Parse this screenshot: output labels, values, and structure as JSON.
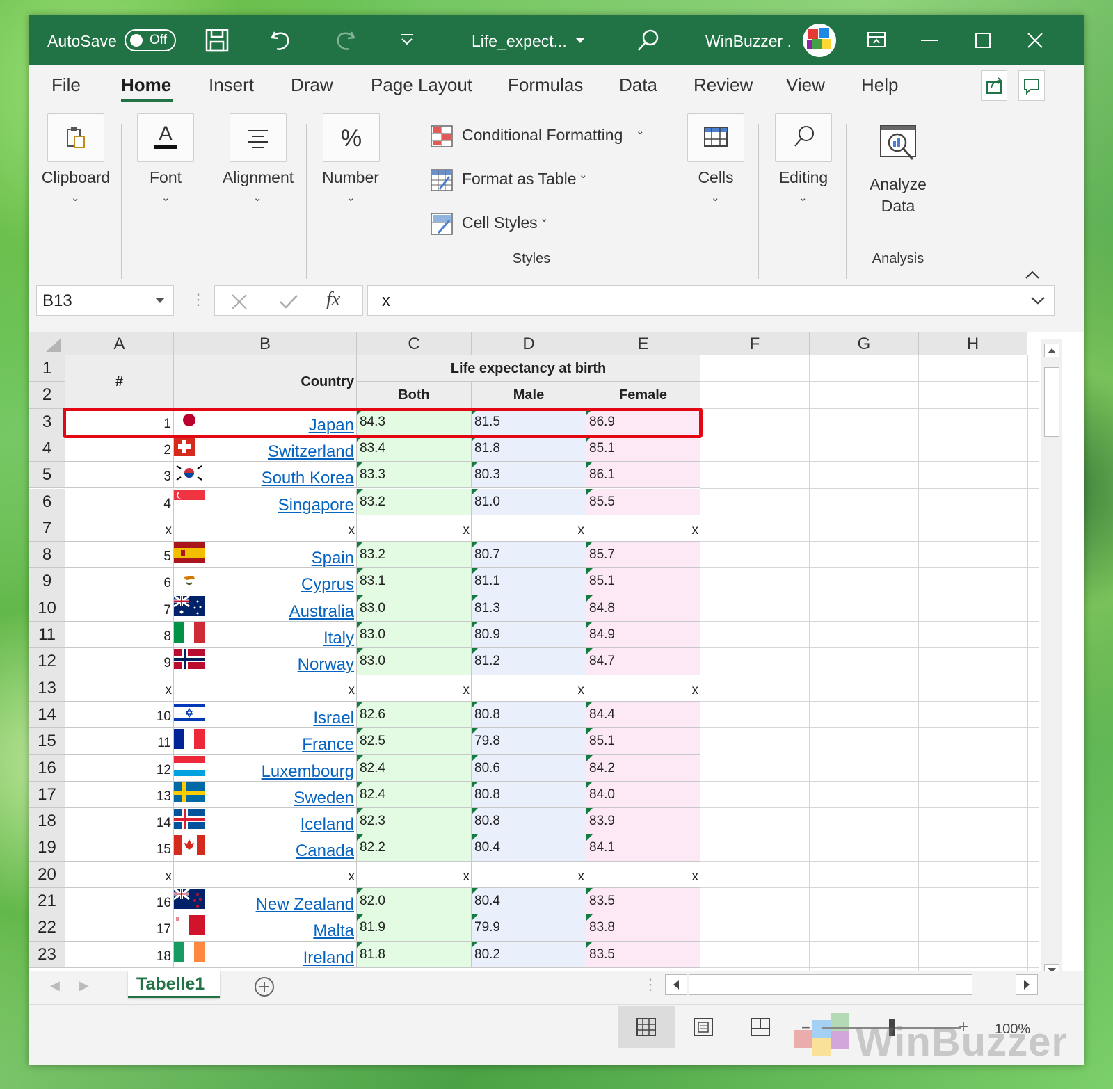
{
  "titlebar": {
    "autosave_label": "AutoSave",
    "autosave_state": "Off",
    "file_name": "Life_expect...",
    "user_name": "WinBuzzer .",
    "brand_color": "#217346"
  },
  "ribbon": {
    "tabs": [
      "File",
      "Home",
      "Insert",
      "Draw",
      "Page Layout",
      "Formulas",
      "Data",
      "Review",
      "View",
      "Help"
    ],
    "active_tab": "Home",
    "groups": {
      "clipboard": "Clipboard",
      "font": "Font",
      "alignment": "Alignment",
      "number": "Number",
      "conditional_formatting": "Conditional Formatting",
      "format_as_table": "Format as Table",
      "cell_styles": "Cell Styles",
      "styles": "Styles",
      "cells": "Cells",
      "editing": "Editing",
      "analyze_line1": "Analyze",
      "analyze_line2": "Data",
      "analysis": "Analysis"
    }
  },
  "formula_bar": {
    "name_box": "B13",
    "fx_label": "fx",
    "formula": "x"
  },
  "grid": {
    "columns": [
      "A",
      "B",
      "C",
      "D",
      "E",
      "F",
      "G",
      "H"
    ],
    "header": {
      "hash": "#",
      "country": "Country",
      "life_expectancy": "Life expectancy at birth",
      "both": "Both",
      "male": "Male",
      "female": "Female"
    },
    "rows": [
      {
        "r": "3",
        "rank": "1",
        "flag": "japan",
        "country": "Japan",
        "both": "84.3",
        "male": "81.5",
        "female": "86.9"
      },
      {
        "r": "4",
        "rank": "2",
        "flag": "switzerland",
        "country": "Switzerland",
        "both": "83.4",
        "male": "81.8",
        "female": "85.1"
      },
      {
        "r": "5",
        "rank": "3",
        "flag": "south-korea",
        "country": "South Korea",
        "both": "83.3",
        "male": "80.3",
        "female": "86.1"
      },
      {
        "r": "6",
        "rank": "4",
        "flag": "singapore",
        "country": "Singapore",
        "both": "83.2",
        "male": "81.0",
        "female": "85.5"
      },
      {
        "r": "7",
        "sep": true,
        "mark": "x"
      },
      {
        "r": "8",
        "rank": "5",
        "flag": "spain",
        "country": "Spain",
        "both": "83.2",
        "male": "80.7",
        "female": "85.7"
      },
      {
        "r": "9",
        "rank": "6",
        "flag": "cyprus",
        "country": "Cyprus",
        "both": "83.1",
        "male": "81.1",
        "female": "85.1"
      },
      {
        "r": "10",
        "rank": "7",
        "flag": "australia",
        "country": "Australia",
        "both": "83.0",
        "male": "81.3",
        "female": "84.8"
      },
      {
        "r": "11",
        "rank": "8",
        "flag": "italy",
        "country": "Italy",
        "both": "83.0",
        "male": "80.9",
        "female": "84.9"
      },
      {
        "r": "12",
        "rank": "9",
        "flag": "norway",
        "country": "Norway",
        "both": "83.0",
        "male": "81.2",
        "female": "84.7"
      },
      {
        "r": "13",
        "sep": true,
        "mark": "x"
      },
      {
        "r": "14",
        "rank": "10",
        "flag": "israel",
        "country": "Israel",
        "both": "82.6",
        "male": "80.8",
        "female": "84.4"
      },
      {
        "r": "15",
        "rank": "11",
        "flag": "france",
        "country": "France",
        "both": "82.5",
        "male": "79.8",
        "female": "85.1"
      },
      {
        "r": "16",
        "rank": "12",
        "flag": "luxembourg",
        "country": "Luxembourg",
        "both": "82.4",
        "male": "80.6",
        "female": "84.2"
      },
      {
        "r": "17",
        "rank": "13",
        "flag": "sweden",
        "country": "Sweden",
        "both": "82.4",
        "male": "80.8",
        "female": "84.0"
      },
      {
        "r": "18",
        "rank": "14",
        "flag": "iceland",
        "country": "Iceland",
        "both": "82.3",
        "male": "80.8",
        "female": "83.9"
      },
      {
        "r": "19",
        "rank": "15",
        "flag": "canada",
        "country": "Canada",
        "both": "82.2",
        "male": "80.4",
        "female": "84.1"
      },
      {
        "r": "20",
        "sep": true,
        "mark": "x"
      },
      {
        "r": "21",
        "rank": "16",
        "flag": "new-zealand",
        "country": "New Zealand",
        "both": "82.0",
        "male": "80.4",
        "female": "83.5"
      },
      {
        "r": "22",
        "rank": "17",
        "flag": "malta",
        "country": "Malta",
        "both": "81.9",
        "male": "79.9",
        "female": "83.8"
      },
      {
        "r": "23",
        "rank": "18",
        "flag": "ireland",
        "country": "Ireland",
        "both": "81.8",
        "male": "80.2",
        "female": "83.5"
      }
    ],
    "fill_colors": {
      "both": "#e2fbe2",
      "male": "#e9f0fb",
      "female": "#fde8f6",
      "header": "#ededed"
    },
    "highlight_color": "#e30613"
  },
  "sheets": {
    "tabs": [
      "Tabelle1"
    ],
    "active": "Tabelle1"
  },
  "status": {
    "zoom": "100%",
    "watermark": "WinBuzzer"
  }
}
